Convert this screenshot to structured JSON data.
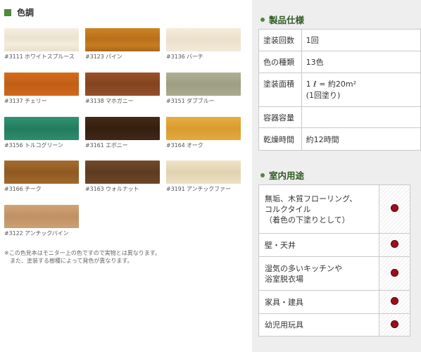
{
  "colors_section": {
    "title": "色調",
    "swatches": [
      {
        "label": "#3111 ホワイトスプルース",
        "color": "#f2ead9"
      },
      {
        "label": "#3123 パイン",
        "color": "#c2781e"
      },
      {
        "label": "#3136 バーチ",
        "color": "#f0e6d2"
      },
      {
        "label": "#3137 チェリー",
        "color": "#c9631a"
      },
      {
        "label": "#3138 マホガニー",
        "color": "#8e4a22"
      },
      {
        "label": "#3151 ダブブルー",
        "color": "#a6a78a"
      },
      {
        "label": "#3156 トルコグリーン",
        "color": "#2a8a6a"
      },
      {
        "label": "#3161 エボニー",
        "color": "#3c2414"
      },
      {
        "label": "#3164 オーク",
        "color": "#e2a63a"
      },
      {
        "label": "#3166 チーク",
        "color": "#9c6428"
      },
      {
        "label": "#3163 ウォルナット",
        "color": "#6a4326"
      },
      {
        "label": "#3191 アンチックファー",
        "color": "#e8dcbc"
      },
      {
        "label": "#3122 アンチックパイン",
        "color": "#c99c6c"
      }
    ],
    "note_line1": "※この色見本はモニター上の色ですので実物とは異なります。",
    "note_line2": "また、塗装する樹種によって発色が異なります。"
  },
  "spec_section": {
    "title": "製品仕様",
    "rows": [
      {
        "key": "塗装回数",
        "value": "1回"
      },
      {
        "key": "色の種類",
        "value": "13色"
      },
      {
        "key": "塗装面積",
        "value": "1 ℓ = 約20m²",
        "value2": "(1回塗り)"
      },
      {
        "key": "容器容量",
        "value": ""
      },
      {
        "key": "乾燥時間",
        "value": "約12時間"
      }
    ]
  },
  "use_section": {
    "title": "室内用途",
    "mark_color": "#9a0e1e",
    "rows": [
      {
        "line1": "無垢、木質フローリング、",
        "line2": "コルクタイル",
        "line3": "（着色の下塗りとして）"
      },
      {
        "line1": "壁・天井"
      },
      {
        "line1": "湿気の多いキッチンや",
        "line2": "浴室脱衣場"
      },
      {
        "line1": "家具・建具"
      },
      {
        "line1": "幼児用玩具"
      }
    ]
  }
}
